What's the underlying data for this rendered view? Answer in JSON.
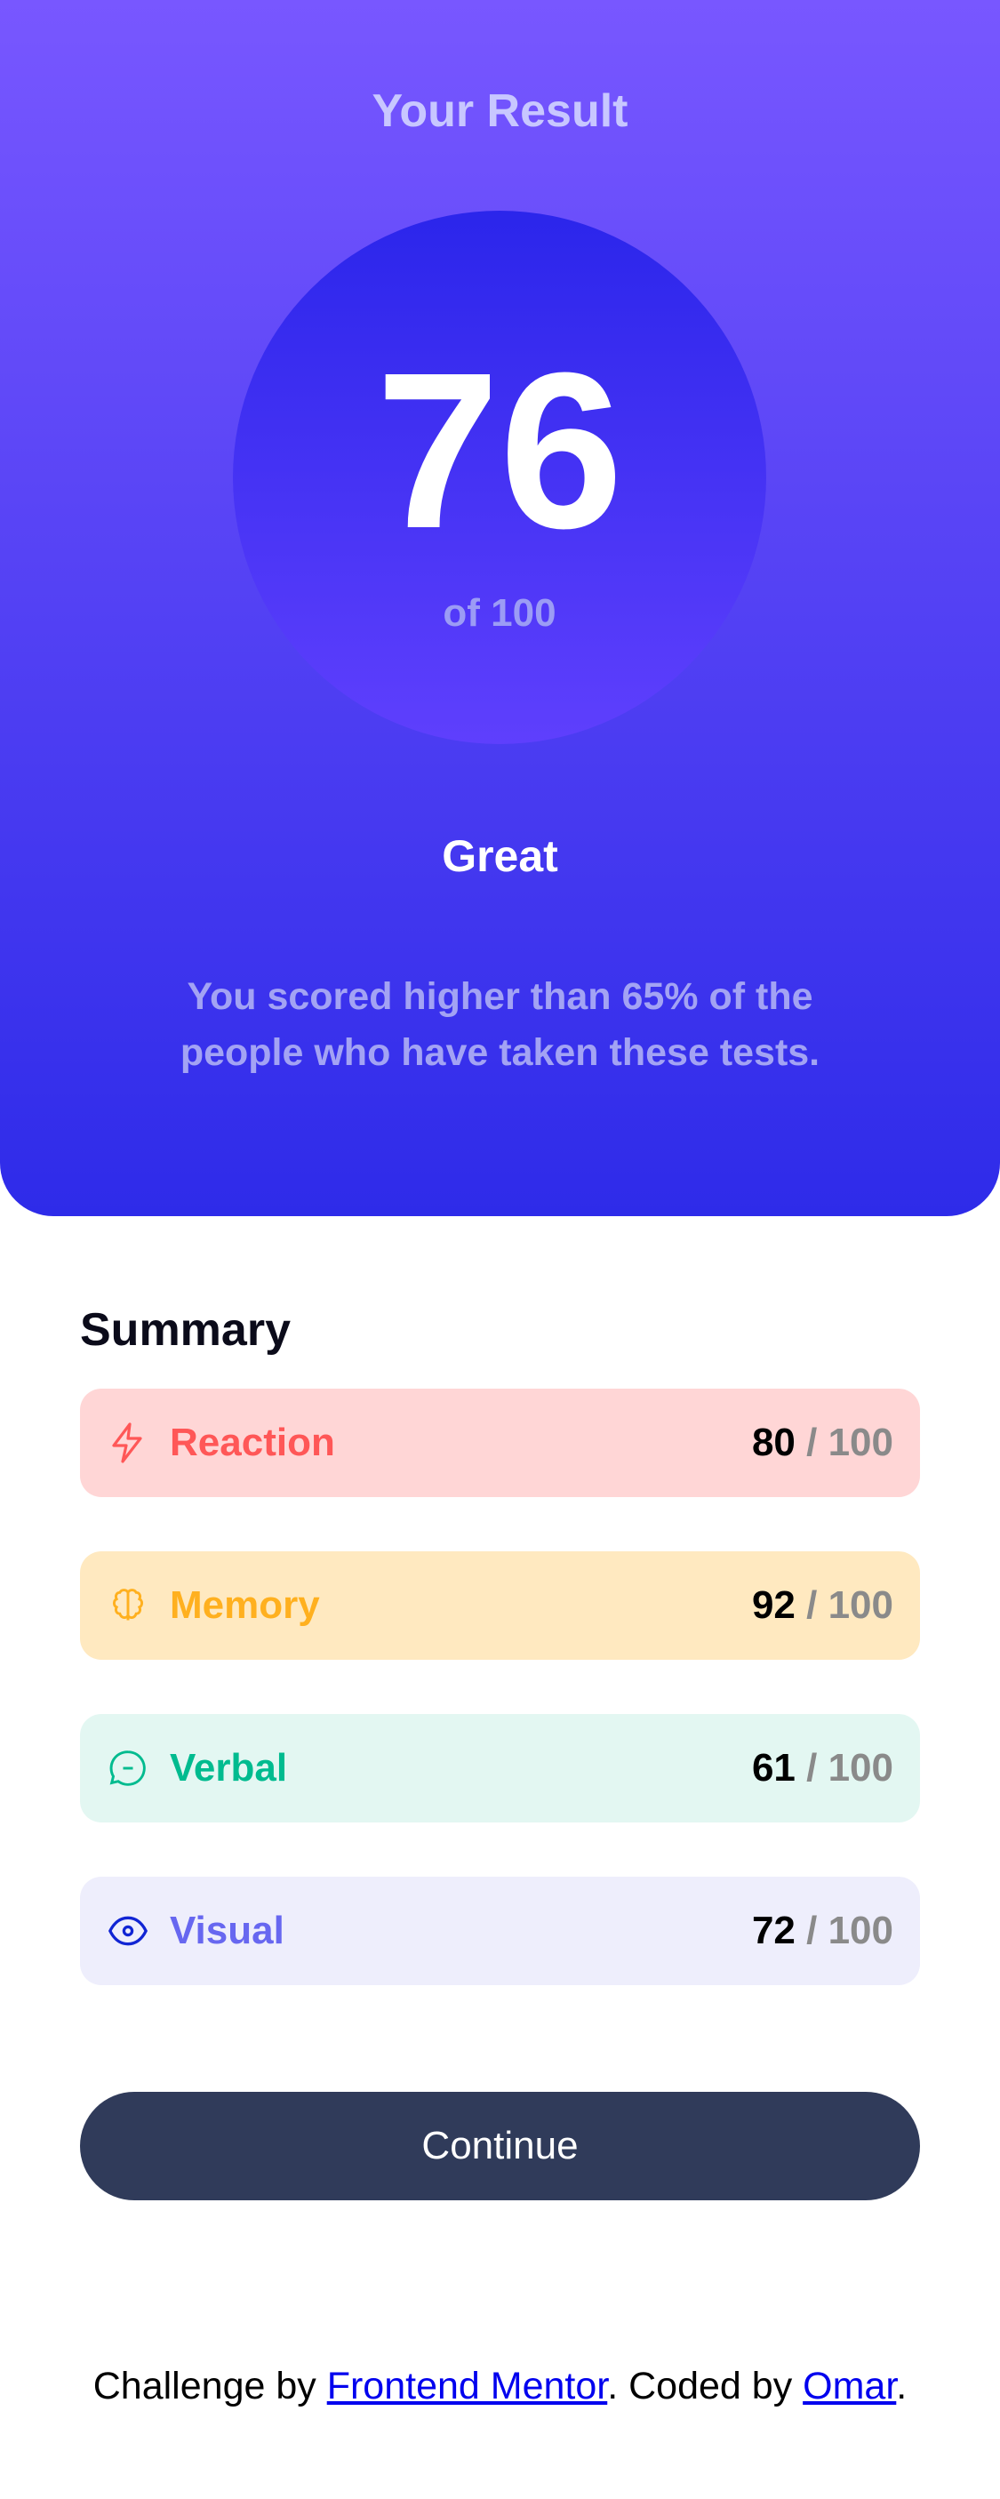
{
  "result": {
    "title": "Your Result",
    "score": "76",
    "of_label": "of 100",
    "grade": "Great",
    "description": "You scored higher than 65% of the people who have taken these tests."
  },
  "summary": {
    "title": "Summary",
    "items": [
      {
        "label": "Reaction",
        "score": "80",
        "max": "/ 100",
        "icon": "lightning-icon",
        "color": "#ff5757",
        "bg": "#ffd6d6"
      },
      {
        "label": "Memory",
        "score": "92",
        "max": "/ 100",
        "icon": "brain-icon",
        "color": "#ffb01f",
        "bg": "#ffe9c0"
      },
      {
        "label": "Verbal",
        "score": "61",
        "max": "/ 100",
        "icon": "chat-bubble-icon",
        "color": "#00bb8f",
        "bg": "#e3f7f2"
      },
      {
        "label": "Visual",
        "score": "72",
        "max": "/ 100",
        "icon": "eye-icon",
        "color": "#6767f0",
        "bg": "#eeeefc"
      }
    ]
  },
  "continue_label": "Continue",
  "footer": {
    "prefix": "Challenge by ",
    "link1": "Frontend Mentor",
    "middle": ". Coded by ",
    "link2": "Omar",
    "suffix": "."
  }
}
